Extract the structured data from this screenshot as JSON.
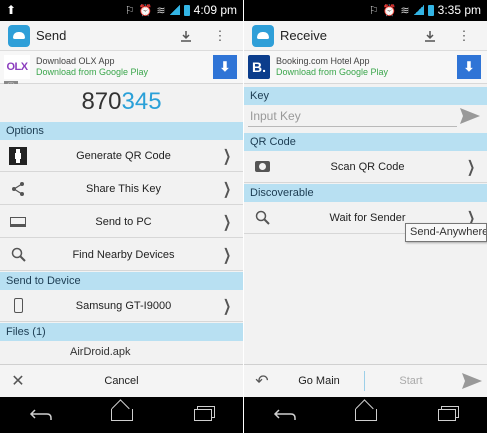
{
  "left": {
    "status": {
      "time": "4:09 pm"
    },
    "appbar": {
      "title": "Send"
    },
    "ad": {
      "logo": "OLX",
      "title": "Download OLX App",
      "subtitle": "Download from Google Play",
      "badge": "ⓘ"
    },
    "key": {
      "part1": "870",
      "part2": "345"
    },
    "sections": {
      "options": "Options",
      "send_to_device": "Send to Device",
      "files": "Files (1)"
    },
    "options": [
      {
        "label": "Generate QR Code",
        "icon": "qr-code-icon"
      },
      {
        "label": "Share This Key",
        "icon": "share-icon"
      },
      {
        "label": "Send to PC",
        "icon": "laptop-icon"
      },
      {
        "label": "Find Nearby Devices",
        "icon": "search-icon"
      }
    ],
    "device": {
      "label": "Samsung GT-I9000",
      "icon": "phone-icon"
    },
    "file": {
      "name": "AirDroid.apk"
    },
    "bottom": {
      "cancel": "Cancel"
    }
  },
  "right": {
    "status": {
      "time": "3:35 pm"
    },
    "appbar": {
      "title": "Receive"
    },
    "ad": {
      "logo": "B.",
      "title": "Booking.com Hotel App",
      "subtitle": "Download from Google Play"
    },
    "sections": {
      "key": "Key",
      "qr": "QR Code",
      "discoverable": "Discoverable"
    },
    "input": {
      "placeholder": "Input Key",
      "value": ""
    },
    "scan": {
      "label": "Scan QR Code",
      "icon": "camera-icon"
    },
    "wait": {
      "label": "Wait for Sender",
      "icon": "search-icon"
    },
    "bottom": {
      "go_main": "Go Main",
      "start": "Start"
    }
  },
  "tooltip": {
    "text": "Send-Anywhere"
  },
  "colors": {
    "accent": "#2aa0d8",
    "section_bg": "#b8e0f2",
    "ad_button": "#2f74d6",
    "ad_subtitle": "#3aa64b"
  }
}
